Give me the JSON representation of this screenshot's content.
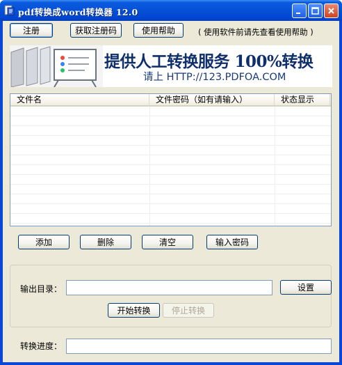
{
  "window": {
    "title": "pdf转换成word转换器 12.0"
  },
  "toolbar": {
    "register_label": "注册",
    "get_code_label": "获取注册码",
    "help_label": "使用帮助",
    "hint": "( 使用软件前请先查看使用帮助 )"
  },
  "banner": {
    "headline": "提供人工转换服务 100%转换",
    "subline": "请上  HTTP://123.PDFOA.COM"
  },
  "file_list": {
    "columns": [
      "文件名",
      "文件密码（如有请输入）",
      "状态显示"
    ],
    "rows": []
  },
  "list_actions": {
    "add_label": "添加",
    "delete_label": "删除",
    "clear_label": "清空",
    "password_label": "输入密码"
  },
  "output": {
    "dir_label": "输出目录：",
    "dir_value": "",
    "settings_label": "设置",
    "start_label": "开始转换",
    "stop_label": "停止转换"
  },
  "progress": {
    "label": "转换进度：",
    "value": 0
  },
  "colors": {
    "titlebar": "#0651d6",
    "window_bg": "#ece9d8",
    "banner_text": "#0f2f6b"
  }
}
